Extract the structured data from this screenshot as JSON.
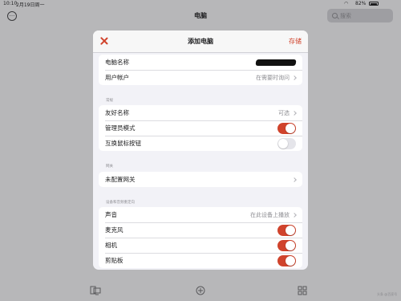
{
  "status_bar": {
    "time": "10:10",
    "date": "2月19日周一",
    "battery": "82%"
  },
  "app": {
    "title": "电脑",
    "search_placeholder": "搜索"
  },
  "modal": {
    "title": "添加电脑",
    "save_label": "存储",
    "group1": {
      "pc_name_label": "电脑名称",
      "user_account_label": "用户帐户",
      "user_account_value": "在需要时询问"
    },
    "general": {
      "header": "常规",
      "friendly_name_label": "友好名称",
      "friendly_name_value": "可选",
      "admin_mode_label": "管理员模式",
      "admin_mode_on": true,
      "swap_mouse_label": "互换鼠标按钮",
      "swap_mouse_on": false
    },
    "gateway": {
      "header": "网关",
      "gateway_label": "未配置网关"
    },
    "redirection": {
      "header": "设备和音频重定向",
      "sound_label": "声音",
      "sound_value": "在此设备上播放",
      "microphone_label": "麦克风",
      "microphone_on": true,
      "camera_label": "相机",
      "camera_on": true,
      "clipboard_label": "剪贴板",
      "clipboard_on": true
    }
  },
  "colors": {
    "accent": "#d0432c",
    "background_dim": "#b7b7b9",
    "sheet_background": "#f2f2f7"
  },
  "icons": {
    "more": "ellipsis-circle-icon",
    "search": "search-icon",
    "close": "close-icon",
    "chevron": "chevron-right-icon",
    "bottom_pcs": "desktop-icon",
    "bottom_add": "plus-circle-icon",
    "bottom_apps": "grid-icon"
  },
  "watermark": "头条 @百家号"
}
